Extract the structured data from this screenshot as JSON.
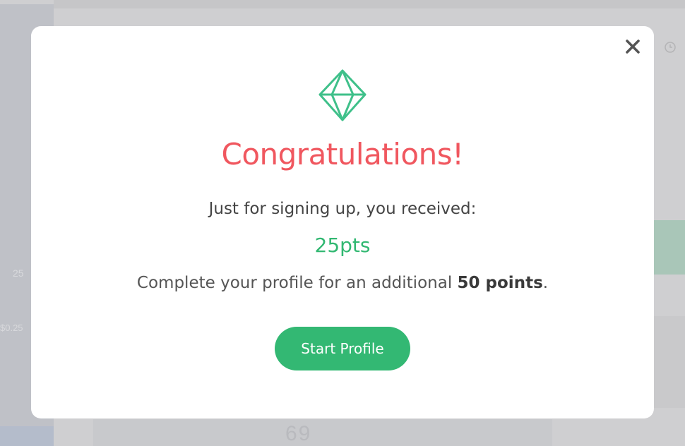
{
  "background": {
    "left_value": "25",
    "left_cost": "$0.25",
    "bottom_digits": "69"
  },
  "modal": {
    "close_icon": "close-icon",
    "badge_icon": "diamond-icon",
    "title": "Congratulations!",
    "subtitle": "Just for signing up, you received:",
    "points_awarded": "25pts",
    "profile_prefix": "Complete your profile for an additional ",
    "profile_bonus": "50 points",
    "profile_suffix": ".",
    "button_label": "Start Profile"
  },
  "colors": {
    "title": "#f0575f",
    "accent_green": "#33b873",
    "overlay": "#cfcfd1"
  }
}
